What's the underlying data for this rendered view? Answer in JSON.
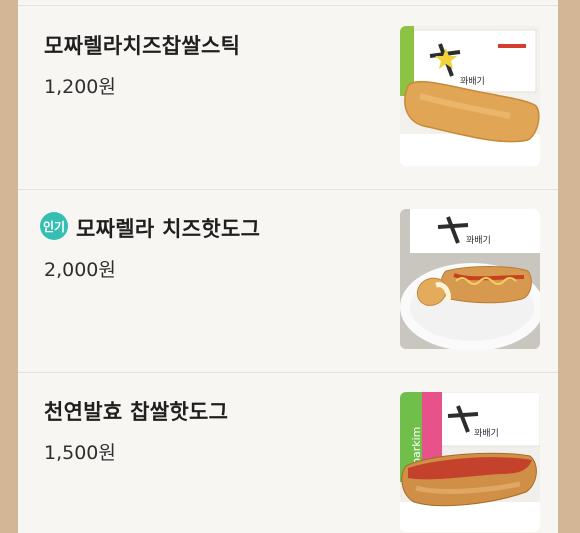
{
  "menu": {
    "items": [
      {
        "name": "모짜렐라치즈찹쌀스틱",
        "price": "1,200원"
      },
      {
        "name": "모짜렐라 치즈핫도그",
        "price": "2,000원",
        "badge": "인기"
      },
      {
        "name": "천연발효 찹쌀핫도그",
        "price": "1,500원"
      }
    ]
  },
  "images": {
    "brand_text": "꽈배기",
    "drink_text": "Sparkim"
  },
  "colors": {
    "page_background": "#d2b695",
    "card_background": "#f7f6f3",
    "badge": "#35bfb3"
  }
}
